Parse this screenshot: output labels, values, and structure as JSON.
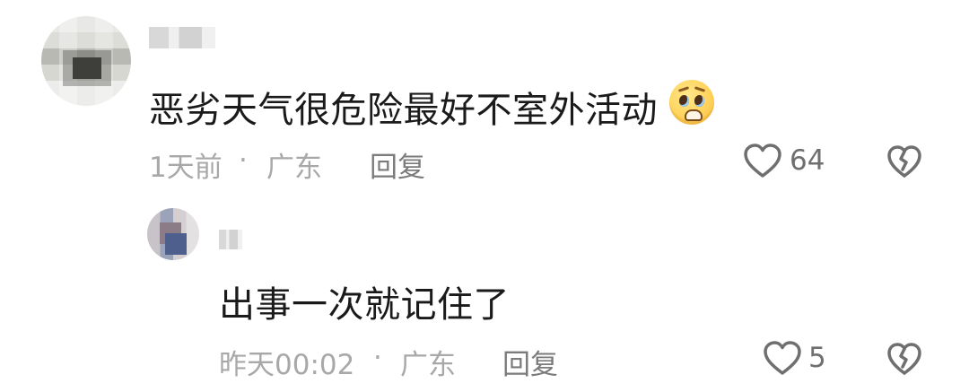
{
  "comments": [
    {
      "text": "恶劣天气很危险最好不室外活动",
      "time": "1天前",
      "separator": "·",
      "location": "广东",
      "reply_label": "回复",
      "likes": "64",
      "emoji": "pleading-face-emoji"
    },
    {
      "text": "出事一次就记住了",
      "time": "昨天00:02",
      "separator": "·",
      "location": "广东",
      "reply_label": "回复",
      "likes": "5"
    }
  ],
  "icons": {
    "like": "heart-outline-icon",
    "dislike": "broken-heart-icon"
  },
  "colors": {
    "primary_text": "#1a1a1a",
    "meta_text": "#a8a8a8",
    "reply_text": "#7b7b7b",
    "icon_stroke": "#6f6f6f",
    "background": "#ffffff"
  }
}
